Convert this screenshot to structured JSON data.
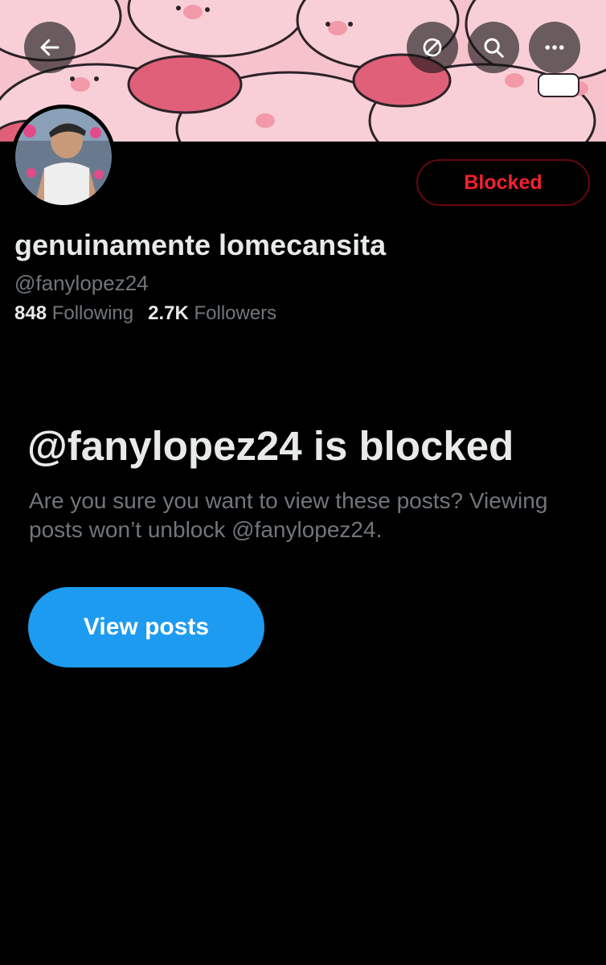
{
  "header": {
    "back_icon": "arrow-left-icon",
    "sync_icon": "circle-slash-icon",
    "search_icon": "search-icon",
    "more_icon": "more-horizontal-icon"
  },
  "profile": {
    "display_name": "genuinamente lomecansita",
    "handle": "@fanylopez24",
    "blocked_label": "Blocked",
    "following_count": "848",
    "following_label": "Following",
    "followers_count": "2.7K",
    "followers_label": "Followers"
  },
  "blocked_notice": {
    "title": "@fanylopez24 is blocked",
    "description": "Are you sure you want to view these posts? Viewing posts won’t unblock @fanylopez24.",
    "view_posts_label": "View posts"
  },
  "colors": {
    "background": "#000000",
    "accent_blue": "#1d9bf0",
    "blocked_red": "#f4212e",
    "muted_text": "#71767b",
    "banner_pink": "#f4b6c2"
  }
}
